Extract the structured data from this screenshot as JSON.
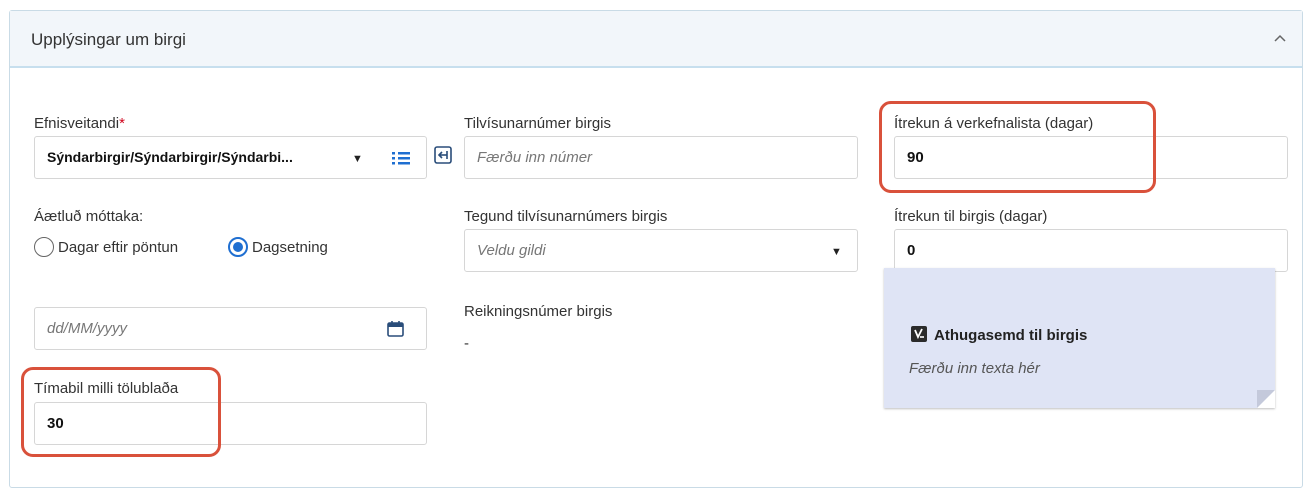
{
  "panel": {
    "title": "Upplýsingar um birgi",
    "collapse_icon": "chevron-up-icon"
  },
  "supplier": {
    "label": "Efnisveitandi",
    "required_mark": "*",
    "value": "Sýndarbirgir/Sýndarbirgir/Sýndarbi...",
    "list_icon": "list-icon",
    "select_icon": "arrow-into-box-icon"
  },
  "ref_number": {
    "label": "Tilvísunarnúmer birgis",
    "placeholder": "Færðu inn númer"
  },
  "reminder_task": {
    "label": "Ítrekun á verkefnalista (dagar)",
    "value": "90"
  },
  "expected_receipt": {
    "label": "Áætluð móttaka:",
    "options": [
      "Dagar eftir pöntun",
      "Dagsetning"
    ],
    "selected": "Dagsetning"
  },
  "ref_type": {
    "label": "Tegund tilvísunarnúmers birgis",
    "placeholder": "Veldu gildi"
  },
  "reminder_supplier": {
    "label": "Ítrekun til birgis (dagar)",
    "value": "0"
  },
  "date": {
    "placeholder": "dd/MM/yyyy",
    "icon": "calendar-icon"
  },
  "invoice_number": {
    "label": "Reikningsnúmer birgis",
    "value": "-"
  },
  "note": {
    "icon": "note-icon",
    "title": "Athugasemd til birgis",
    "placeholder": "Færðu inn texta hér"
  },
  "interval": {
    "label": "Tímabil milli tölublaða",
    "value": "30"
  },
  "colors": {
    "accent": "#1f6fd1",
    "highlight": "#d9513b",
    "note_bg": "#dfe4f5",
    "header_bg": "#f2f6fa"
  }
}
